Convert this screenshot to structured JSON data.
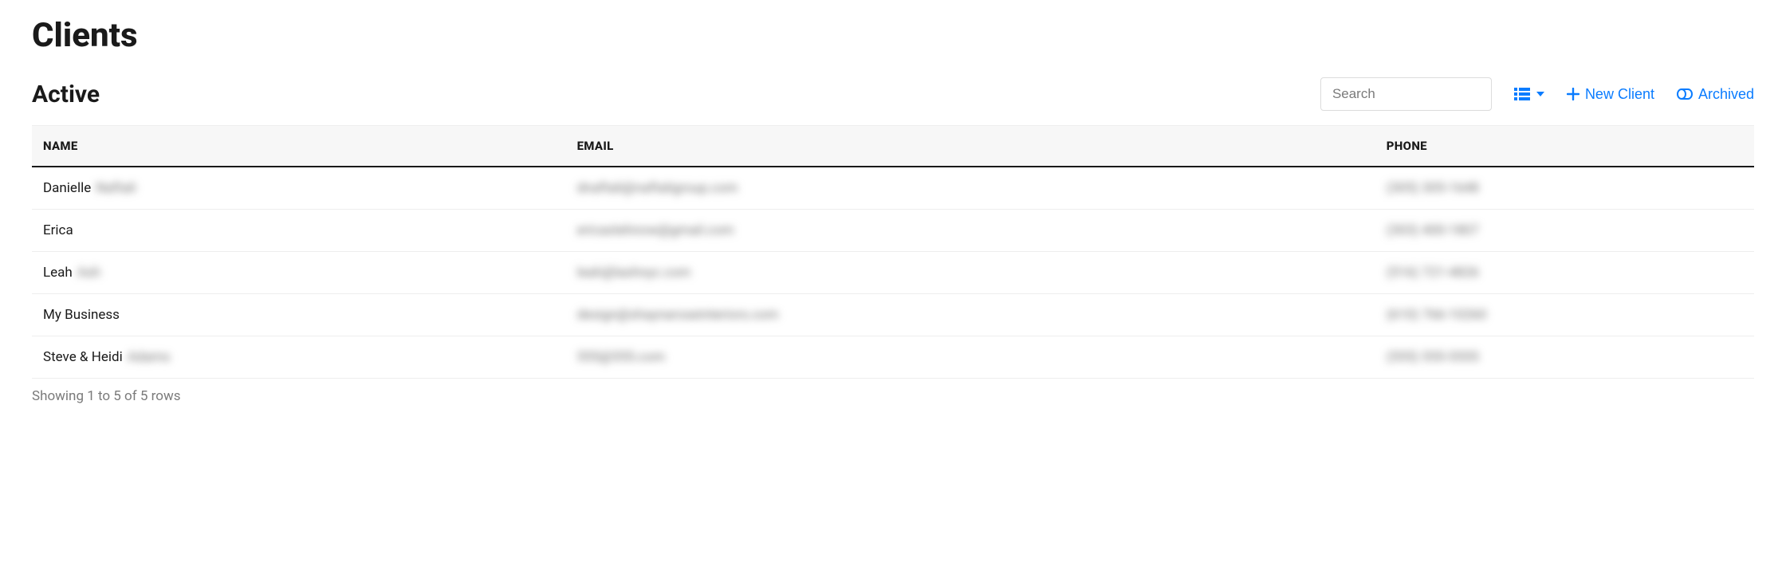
{
  "page": {
    "title": "Clients"
  },
  "section": {
    "title": "Active"
  },
  "search": {
    "placeholder": "Search",
    "value": ""
  },
  "actions": {
    "new_client_label": "New Client",
    "archived_label": "Archived"
  },
  "table": {
    "columns": {
      "name": "NAME",
      "email": "EMAIL",
      "phone": "PHONE"
    },
    "rows": [
      {
        "name_visible": "Danielle",
        "name_blurred": "Naftali",
        "email_blurred": "dnaftali@naftaligroup.com",
        "phone_blurred": "(305) 305-1648"
      },
      {
        "name_visible": "Erica",
        "name_blurred": "",
        "email_blurred": "ericastehnow@gmail.com",
        "phone_blurred": "(303) 400-1807"
      },
      {
        "name_visible": "Leah",
        "name_blurred": "Ash",
        "email_blurred": "leah@lashnyc.com",
        "phone_blurred": "(516) 721-4826"
      },
      {
        "name_visible": "My Business",
        "name_blurred": "",
        "email_blurred": "design@shaynaroseinteriors.com",
        "phone_blurred": "(610) 766-10260"
      },
      {
        "name_visible": "Steve & Heidi",
        "name_blurred": "Adams",
        "email_blurred": "555@555.com",
        "phone_blurred": "(555) 555-5555"
      }
    ],
    "footer": "Showing 1 to 5 of 5 rows"
  }
}
